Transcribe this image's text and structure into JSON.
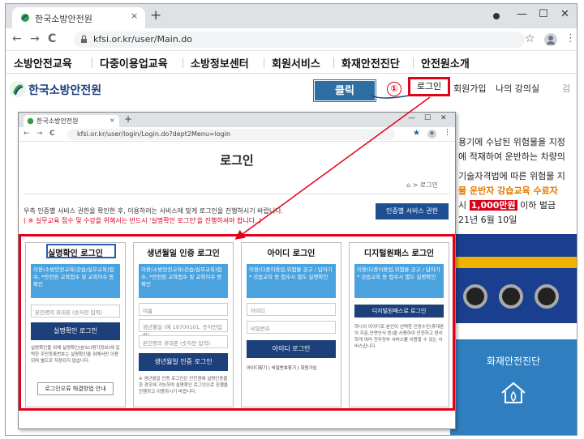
{
  "browser": {
    "tab_title": "한국소방안전원",
    "tab_close": "×",
    "new_tab": "+",
    "url": "kfsi.or.kr/user/Main.do",
    "back": "←",
    "forward": "→",
    "reload": "C",
    "min": "—",
    "max": "☐",
    "close": "✕"
  },
  "menu": {
    "items": [
      "소방안전교육",
      "다중이용업교육",
      "소방정보센터",
      "회원서비스",
      "화재안전진단",
      "안전원소개"
    ]
  },
  "header": {
    "logo_text": "한국소방안전원",
    "click_label": "클릭",
    "step1": "①",
    "login": "로그인",
    "join": "회원가입",
    "my_courses": "나의 강의실",
    "search_stub": "검"
  },
  "banner": {
    "line1": "용기에 수납된 위험물을 지정",
    "line2": "에 적재하여 운반하는 차량의",
    "line3": "기술자격법에 따른 위험물 지",
    "line4": "물 운반자 강습교육 수료자",
    "line5a": "시 ",
    "line5_money": "1,000만원",
    "line5b": " 이하 벌금",
    "line6": "21년 6월 10일",
    "fire_label": "화재안전진단"
  },
  "inner": {
    "tab_title": "한국소방안전원",
    "url": "kfsi.or.kr/user/login/Login.do?dept2Menu=login",
    "heading": "로그인",
    "breadcrumb": "⌂  >  로그인",
    "info1": "우측 인증별 서비스 권한을 확인한 후, 이용하려는 서비스에 맞게 로그인을 진행하시기 바랍니다.",
    "info2": "( ※ 실무교육 접수 및 수강을 위해서는 반드시 '실명확인 로그인'을 진행하셔야 합니다. )",
    "perm_button": "인증별 서비스 권한",
    "step2": "②",
    "columns": [
      {
        "title": "실명확인 로그인",
        "info": "이용(소방안전교육(강습/실무교육)접수, *안전원 교육접수 및 교육이수 등 확인",
        "inputs": [
          "본인명의 휴대폰 (숫자만 입력)"
        ],
        "button": "실명확인 로그인",
        "small": "실명확인을 위해 실명확인(본SCI평가정보)에 입력한 주민등록번호는 실명확인을 위해서만 이용되며 별도로 저장되지 않습니다.",
        "outline": "로그인오류 해결방법 안내"
      },
      {
        "title": "생년월일 인증 로그인",
        "info": "이용(소방안전교육(강습/실무교육)접수, *안전원 교육접수 및 교육이수 등 확인",
        "inputs": [
          "이름",
          "생년월일 (예 19700101, 숫자만입력)",
          "본인명의 휴대폰 (숫자만 입력)"
        ],
        "button": "생년월일 인증 로그인",
        "small": "※ 생년월일 인증 로그인은 안전원에 실명인증을 한 경우에 가능하며 실명확인 로그인으로 진행을 진행하고 이용하시기 바랍니다."
      },
      {
        "title": "아이디 로그인",
        "info": "이용(다중이용업,위험물 공고 / 답하기 * 강습교육 등 접수시 별도 실명확인",
        "inputs": [
          "아이디",
          "비밀번호"
        ],
        "button": "아이디 로그인",
        "links": "아이디찾기 | 비밀번호찾기 | 회원가입"
      },
      {
        "title": "디지털원패스 로그인",
        "info": "이용(다중이용업,위험물 공고 / 답하기 * 강습교육 등 접수시 별도 실명확인",
        "button": "디지털원패스로 로그인",
        "small": "하나의 아이디로 본인이 선택한 인증수단(휴대폰의 지문,안면인식 등)을 사용하여 안전하고 편리하게 여러 전자정부 서비스를 이용할 수 있는 서비스입니다."
      }
    ]
  },
  "colors": {
    "annotation_red": "#e5001a",
    "brand_blue": "#1d3f7a",
    "info_blue": "#4aa3df",
    "click_blue": "#2e6ea3"
  }
}
